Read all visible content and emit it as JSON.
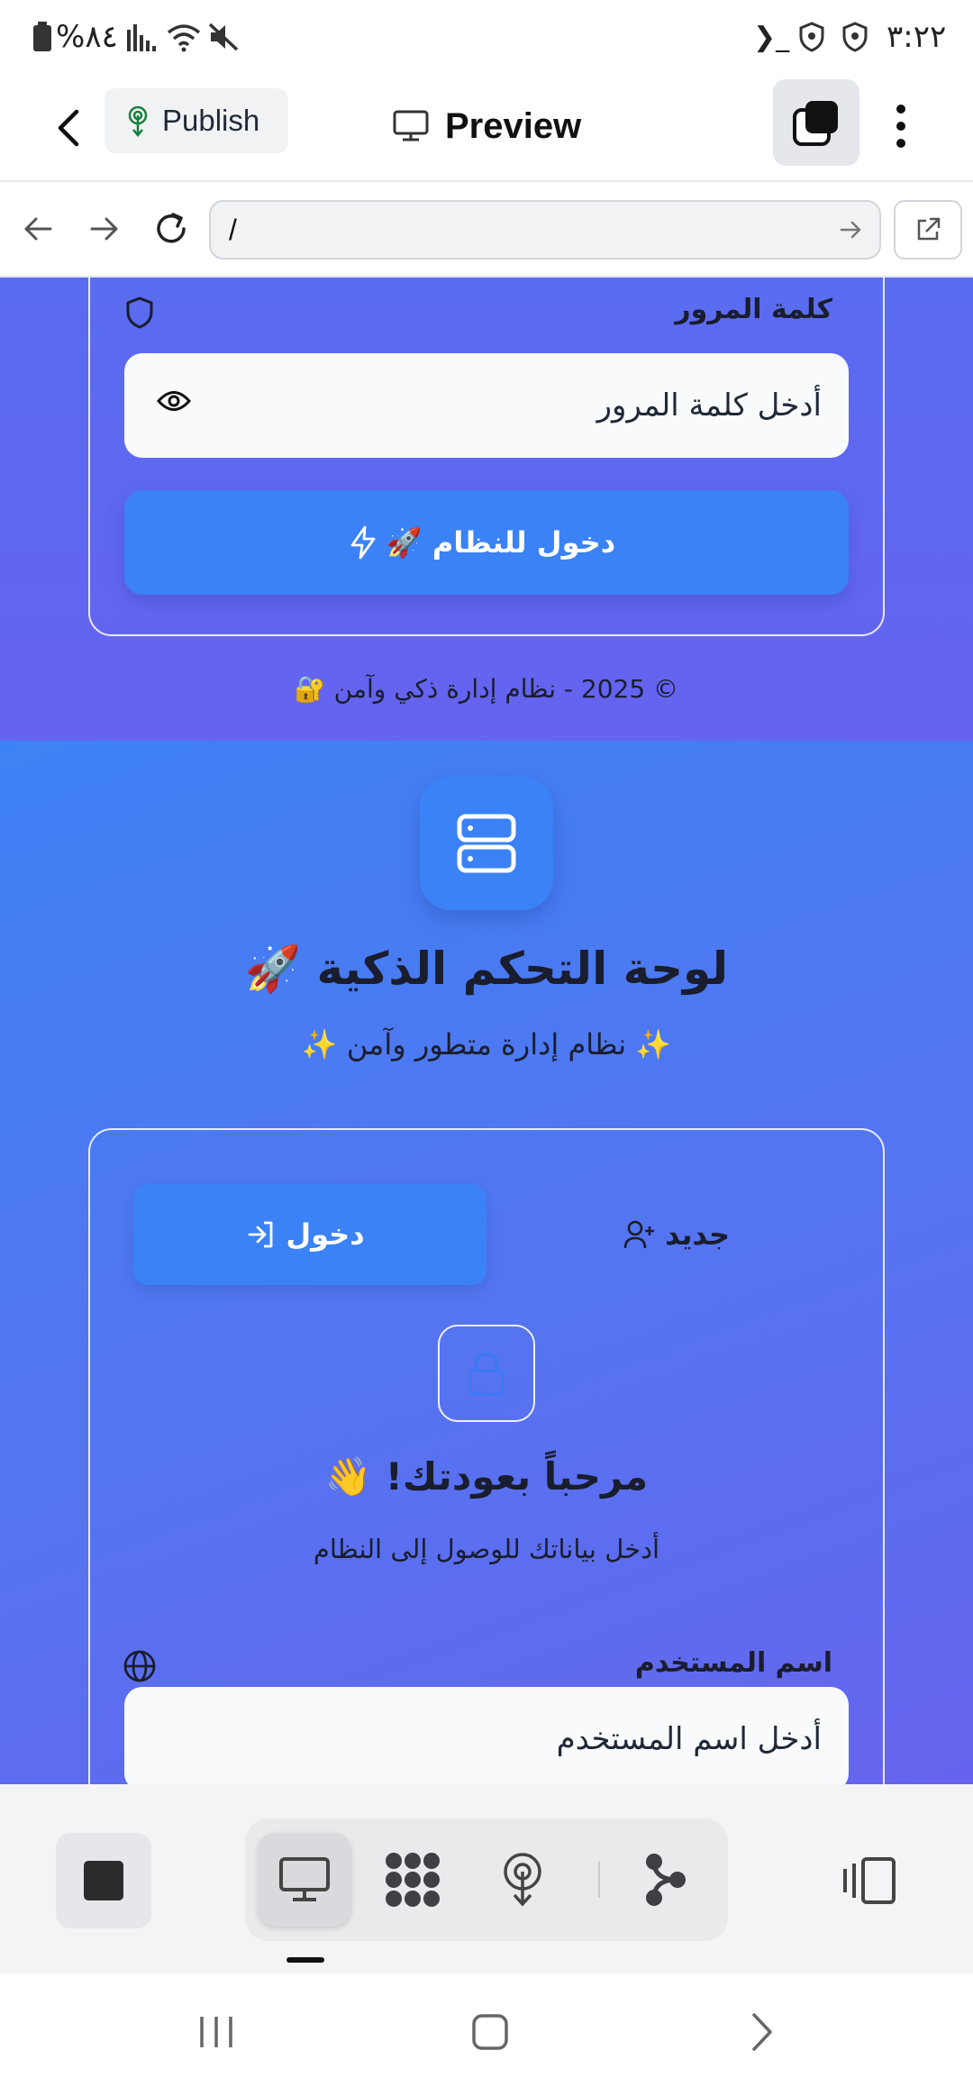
{
  "status_bar": {
    "time": "٣:٢٢",
    "battery": "%٨٤",
    "terminal_glyph": "❯_"
  },
  "header": {
    "publish_label": "Publish",
    "title": "Preview"
  },
  "browser": {
    "url": "/"
  },
  "login_top": {
    "password_label": "كلمة المرور",
    "password_placeholder": "أدخل كلمة المرور",
    "submit_label": "دخول للنظام 🚀",
    "footer": "© 2025 - نظام إدارة ذكي وآمن 🔐"
  },
  "hero": {
    "title": "لوحة التحكم الذكية 🚀",
    "subtitle": "✨ نظام إدارة متطور وآمن ✨"
  },
  "auth_card": {
    "tab_login": "دخول",
    "tab_new": "جديد",
    "welcome_title": "مرحباً بعودتك! 👋",
    "welcome_subtitle": "أدخل بياناتك للوصول إلى النظام",
    "username_label": "اسم المستخدم",
    "username_placeholder": "أدخل اسم المستخدم"
  },
  "colors": {
    "primary": "#3b82f6",
    "gradient_start": "#3d82f4",
    "gradient_end": "#6664ee"
  },
  "icons": {
    "toolbar": [
      "stop-icon",
      "monitor-icon",
      "grid-icon",
      "deploy-icon",
      "branch-icon",
      "panel-icon"
    ]
  }
}
